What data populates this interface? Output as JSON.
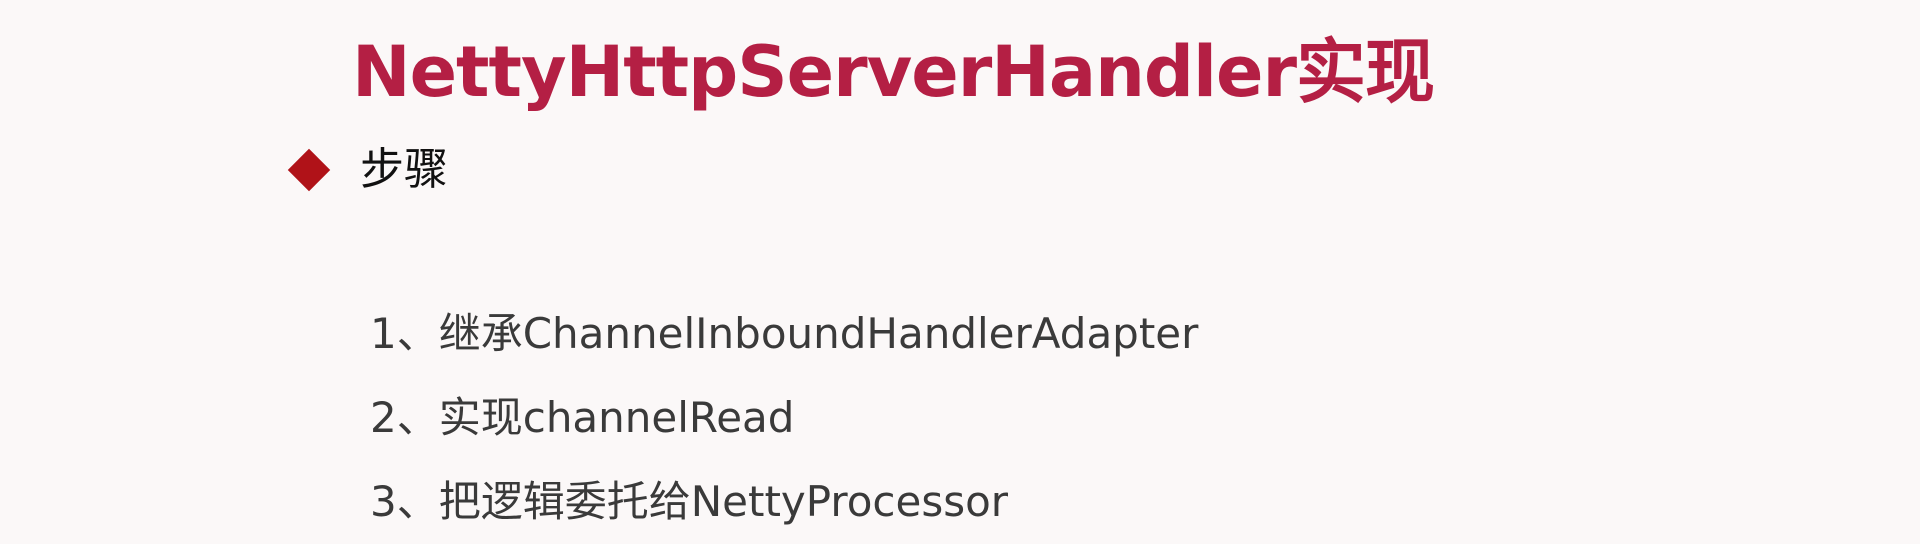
{
  "slide": {
    "title": "NettyHttpServerHandler实现",
    "bullet": {
      "icon": "diamond-bullet-icon",
      "color": "#b01218",
      "text": "步骤"
    },
    "steps": [
      "1、继承ChannelInboundHandlerAdapter",
      "2、实现channelRead",
      "3、把逻辑委托给NettyProcessor"
    ],
    "title_color": "#b41f44"
  }
}
